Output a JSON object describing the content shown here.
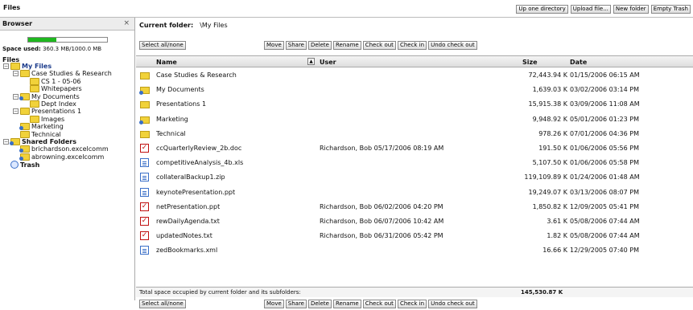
{
  "title": "Files",
  "top_buttons": [
    "Up one directory",
    "Upload file...",
    "New folder",
    "Empty Trash"
  ],
  "sidebar": {
    "header": "Browser",
    "close_glyph": "×",
    "quota": {
      "label": "Space used:",
      "value": "360.3 MB/1000.0 MB",
      "fraction": 0.36
    },
    "files_label": "Files",
    "tree": [
      {
        "label": "My Files",
        "level": 0,
        "expander": "−",
        "icon": "folder-icon",
        "selected": true
      },
      {
        "label": "Case Studies & Research",
        "level": 1,
        "expander": "−",
        "icon": "folder-icon"
      },
      {
        "label": "CS 1 - 05-06",
        "level": 2,
        "expander": "",
        "icon": "folder-icon"
      },
      {
        "label": "Whitepapers",
        "level": 2,
        "expander": "",
        "icon": "folder-icon"
      },
      {
        "label": "My Documents",
        "level": 1,
        "expander": "−",
        "icon": "shared-folder-icon"
      },
      {
        "label": "Dept Index",
        "level": 2,
        "expander": "",
        "icon": "folder-icon"
      },
      {
        "label": "Presentations 1",
        "level": 1,
        "expander": "−",
        "icon": "folder-icon"
      },
      {
        "label": "Images",
        "level": 2,
        "expander": "",
        "icon": "folder-icon"
      },
      {
        "label": "Marketing",
        "level": 1,
        "expander": "",
        "icon": "shared-folder-icon"
      },
      {
        "label": "Technical",
        "level": 1,
        "expander": "",
        "icon": "folder-icon"
      },
      {
        "label": "Shared Folders",
        "level": 0,
        "expander": "−",
        "icon": "shared-folder-icon",
        "bold": true
      },
      {
        "label": "brichardson.excelcomm",
        "level": 1,
        "expander": "",
        "icon": "shared-folder-icon"
      },
      {
        "label": "abrowning.excelcomm",
        "level": 1,
        "expander": "",
        "icon": "shared-folder-icon"
      },
      {
        "label": "Trash",
        "level": 0,
        "expander": "",
        "icon": "trash-icon",
        "bold": true
      }
    ]
  },
  "breadcrumb": {
    "label": "Current folder:",
    "path": "\\My Files"
  },
  "select_all_label": "Select all/none",
  "actions": [
    "Move",
    "Share",
    "Delete",
    "Rename",
    "Check out",
    "Check in",
    "Undo check out"
  ],
  "columns": {
    "name": "Name",
    "user": "User",
    "size": "Size",
    "date": "Date"
  },
  "rows": [
    {
      "icon": "folder",
      "name": "Case Studies & Research",
      "user": "",
      "size": "72,443.94 K",
      "date": "01/15/2006 06:15 AM"
    },
    {
      "icon": "shared",
      "name": "My Documents",
      "user": "",
      "size": "1,639.03 K",
      "date": "03/02/2006 03:14 PM"
    },
    {
      "icon": "folder",
      "name": "Presentations 1",
      "user": "",
      "size": "15,915.38 K",
      "date": "03/09/2006 11:08 AM"
    },
    {
      "icon": "shared",
      "name": "Marketing",
      "user": "",
      "size": "9,948.92 K",
      "date": "05/01/2006 01:23 PM"
    },
    {
      "icon": "folder",
      "name": "Technical",
      "user": "",
      "size": "978.26 K",
      "date": "07/01/2006 04:36 PM"
    },
    {
      "icon": "checkedout",
      "name": "ccQuarterlyReview_2b.doc",
      "user": "Richardson, Bob 05/17/2006 08:19 AM",
      "size": "191.50 K",
      "date": "01/06/2006 05:56 PM"
    },
    {
      "icon": "doc",
      "name": "competitiveAnalysis_4b.xls",
      "user": "",
      "size": "5,107.50 K",
      "date": "01/06/2006 05:58 PM"
    },
    {
      "icon": "doc",
      "name": "collateralBackup1.zip",
      "user": "",
      "size": "119,109.89 K",
      "date": "01/24/2006 01:48 AM"
    },
    {
      "icon": "doc",
      "name": "keynotePresentation.ppt",
      "user": "",
      "size": "19,249.07 K",
      "date": "03/13/2006 08:07 PM"
    },
    {
      "icon": "checkedout",
      "name": "netPresentation.ppt",
      "user": "Richardson, Bob 06/02/2006 04:20 PM",
      "size": "1,850.82 K",
      "date": "12/09/2005 05:41 PM"
    },
    {
      "icon": "checkedout",
      "name": "rewDailyAgenda.txt",
      "user": "Richardson, Bob 06/07/2006 10:42 AM",
      "size": "3.61 K",
      "date": "05/08/2006 07:44 AM"
    },
    {
      "icon": "checkedout",
      "name": "updatedNotes.txt",
      "user": "Richardson, Bob 06/31/2006 05:42 PM",
      "size": "1.82 K",
      "date": "05/08/2006 07:44 AM"
    },
    {
      "icon": "doc",
      "name": "zedBookmarks.xml",
      "user": "",
      "size": "16.66 K",
      "date": "12/29/2005 07:40 PM"
    }
  ],
  "total": {
    "label": "Total space occupied by current folder and its subfolders:",
    "value": "145,530.87 K"
  }
}
